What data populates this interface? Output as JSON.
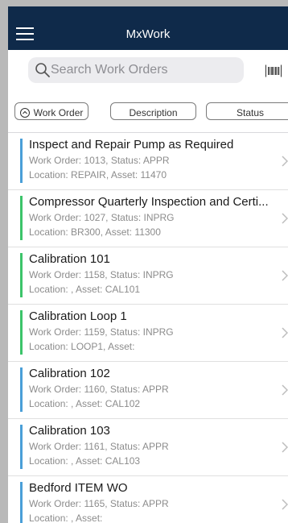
{
  "app": {
    "title": "MxWork"
  },
  "search": {
    "placeholder": "Search Work Orders"
  },
  "sort_buttons": [
    {
      "label": "Work Order",
      "active": true
    },
    {
      "label": "Description",
      "active": false
    },
    {
      "label": "Status",
      "active": false
    }
  ],
  "status_colors": {
    "APPR": "#4a9fd8",
    "INPRG": "#3cc46a"
  },
  "work_orders": [
    {
      "title": "Inspect and Repair Pump as Required",
      "line2": "Work Order: 1013, Status: APPR",
      "line3": "Location: REPAIR, Asset: 11470",
      "status": "APPR"
    },
    {
      "title": "Compressor Quarterly Inspection and Certi...",
      "line2": "Work Order: 1027, Status: INPRG",
      "line3": "Location: BR300, Asset: 11300",
      "status": "INPRG"
    },
    {
      "title": "Calibration 101",
      "line2": "Work Order: 1158, Status: INPRG",
      "line3": "Location: , Asset: CAL101",
      "status": "INPRG"
    },
    {
      "title": "Calibration Loop 1",
      "line2": "Work Order: 1159, Status: INPRG",
      "line3": "Location: LOOP1, Asset:",
      "status": "INPRG"
    },
    {
      "title": "Calibration 102",
      "line2": "Work Order: 1160, Status: APPR",
      "line3": "Location: , Asset: CAL102",
      "status": "APPR"
    },
    {
      "title": "Calibration 103",
      "line2": "Work Order: 1161, Status: APPR",
      "line3": "Location: , Asset: CAL103",
      "status": "APPR"
    },
    {
      "title": "Bedford ITEM WO",
      "line2": "Work Order: 1165, Status: APPR",
      "line3": "Location: , Asset:",
      "status": "APPR"
    }
  ],
  "icons": {
    "menu": "hamburger-menu-icon",
    "search": "magnifier-icon",
    "barcode": "barcode-icon",
    "sort": "up-arrow-circle-icon",
    "chevron": "chevron-right-icon"
  }
}
